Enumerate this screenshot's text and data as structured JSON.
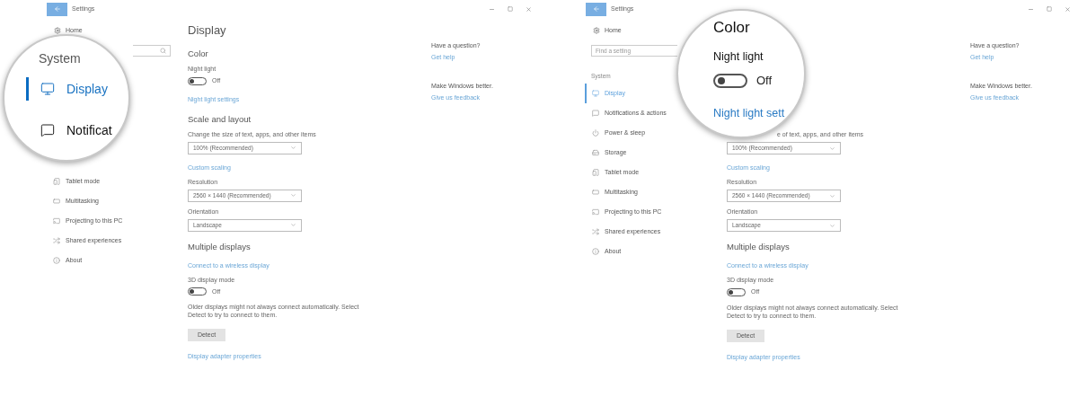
{
  "panels": [
    {
      "window": {
        "title": "Settings"
      },
      "sidebar": {
        "home": "Home",
        "items": [
          {
            "label": "Tablet mode",
            "kind": "tablet",
            "selected": false
          },
          {
            "label": "Multitasking",
            "kind": "multitasking",
            "selected": false
          },
          {
            "label": "Projecting to this PC",
            "kind": "projecting",
            "selected": false
          },
          {
            "label": "Shared experiences",
            "kind": "shared",
            "selected": false
          },
          {
            "label": "About",
            "kind": "about",
            "selected": false
          }
        ]
      },
      "content": [
        {
          "kind": "title",
          "text": "Display"
        },
        {
          "kind": "heading",
          "text": "Color"
        },
        {
          "kind": "label",
          "text": "Night light"
        },
        {
          "kind": "toggle",
          "on": false,
          "state": "Off"
        },
        {
          "kind": "link",
          "text": "Night light settings"
        },
        {
          "kind": "heading",
          "text": "Scale and layout"
        },
        {
          "kind": "label",
          "text": "Change the size of text, apps, and other items"
        },
        {
          "kind": "dropdown",
          "value": "100% (Recommended)"
        },
        {
          "kind": "link",
          "text": "Custom scaling"
        },
        {
          "kind": "label",
          "text": "Resolution"
        },
        {
          "kind": "dropdown",
          "value": "2560 × 1440 (Recommended)"
        },
        {
          "kind": "label",
          "text": "Orientation"
        },
        {
          "kind": "dropdown",
          "value": "Landscape"
        },
        {
          "kind": "heading",
          "text": "Multiple displays"
        },
        {
          "kind": "link",
          "text": "Connect to a wireless display"
        },
        {
          "kind": "label",
          "text": "3D display mode"
        },
        {
          "kind": "toggle",
          "on": false,
          "state": "Off"
        },
        {
          "kind": "text",
          "text": "Older displays might not always connect automatically. Select Detect to try to connect to them."
        },
        {
          "kind": "button",
          "text": "Detect"
        },
        {
          "kind": "link",
          "text": "Display adapter properties"
        }
      ],
      "help": [
        {
          "question": "Have a question?",
          "link": "Get help"
        },
        {
          "question": "Make Windows better.",
          "link": "Give us feedback"
        }
      ],
      "magnifier": {
        "kind": "sidebar",
        "section": "System",
        "items": [
          {
            "label": "Display",
            "kind": "display",
            "selected": true
          },
          {
            "label": "Notificat",
            "kind": "notifications",
            "selected": false
          }
        ]
      }
    },
    {
      "window": {
        "title": "Settings"
      },
      "sidebar": {
        "home": "Home",
        "search": {
          "placeholder": "Find a setting"
        },
        "section": "System",
        "items": [
          {
            "label": "Display",
            "kind": "display",
            "selected": true
          },
          {
            "label": "Notifications & actions",
            "kind": "notifications",
            "selected": false
          },
          {
            "label": "Power & sleep",
            "kind": "power",
            "selected": false
          },
          {
            "label": "Storage",
            "kind": "storage",
            "selected": false
          },
          {
            "label": "Tablet mode",
            "kind": "tablet",
            "selected": false
          },
          {
            "label": "Multitasking",
            "kind": "multitasking",
            "selected": false
          },
          {
            "label": "Projecting to this PC",
            "kind": "projecting",
            "selected": false
          },
          {
            "label": "Shared experiences",
            "kind": "shared",
            "selected": false
          },
          {
            "label": "About",
            "kind": "about",
            "selected": false
          }
        ]
      },
      "content": [
        {
          "kind": "partial_label",
          "text": "e of text, apps, and other items"
        },
        {
          "kind": "dropdown",
          "value": "100% (Recommended)"
        },
        {
          "kind": "link",
          "text": "Custom scaling"
        },
        {
          "kind": "label",
          "text": "Resolution"
        },
        {
          "kind": "dropdown",
          "value": "2560 × 1440 (Recommended)"
        },
        {
          "kind": "label",
          "text": "Orientation"
        },
        {
          "kind": "dropdown",
          "value": "Landscape"
        },
        {
          "kind": "heading",
          "text": "Multiple displays"
        },
        {
          "kind": "link",
          "text": "Connect to a wireless display"
        },
        {
          "kind": "label",
          "text": "3D display mode"
        },
        {
          "kind": "toggle",
          "on": false,
          "state": "Off"
        },
        {
          "kind": "text",
          "text": "Older displays might not always connect automatically. Select Detect to try to connect to them."
        },
        {
          "kind": "button",
          "text": "Detect"
        },
        {
          "kind": "link",
          "text": "Display adapter properties"
        }
      ],
      "help": [
        {
          "question": "Have a question?",
          "link": "Get help"
        },
        {
          "question": "Make Windows better.",
          "link": "Give us feedback"
        }
      ],
      "magnifier": {
        "kind": "setting",
        "heading": "Color",
        "label": "Night light",
        "toggle": {
          "on": false,
          "state": "Off"
        },
        "link": "Night light sett"
      }
    }
  ]
}
